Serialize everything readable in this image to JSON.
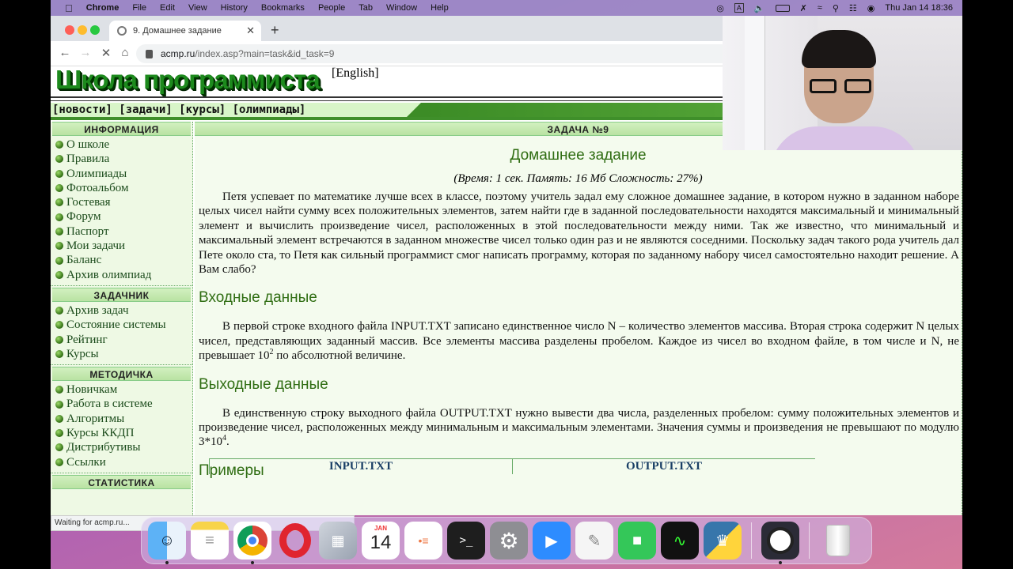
{
  "menubar": {
    "app": "Chrome",
    "items": [
      "File",
      "Edit",
      "View",
      "History",
      "Bookmarks",
      "People",
      "Tab",
      "Window",
      "Help"
    ],
    "clock": "Thu Jan 14  18:36",
    "input_source": "A"
  },
  "browser": {
    "tab_title": "9. Домашнее задание",
    "url_host": "acmp.ru",
    "url_path": "/index.asp?main=task&id_task=9",
    "status_text": "Waiting for acmp.ru..."
  },
  "site": {
    "logo": "Школа программиста",
    "lang_link": "[English]",
    "topnav": [
      "[новости]",
      "[задачи]",
      "[курсы]",
      "[олимпиады]"
    ]
  },
  "sidebar": {
    "sections": [
      {
        "title": "ИНФОРМАЦИЯ",
        "items": [
          "О школе",
          "Правила",
          "Олимпиады",
          "Фотоальбом",
          "Гостевая",
          "Форум",
          "Паспорт",
          "Мои задачи",
          "Баланс",
          "Архив олимпиад"
        ]
      },
      {
        "title": "ЗАДАЧНИК",
        "items": [
          "Архив задач",
          "Состояние системы",
          "Рейтинг",
          "Курсы"
        ]
      },
      {
        "title": "МЕТОДИЧКА",
        "items": [
          "Новичкам",
          "Работа в системе",
          "Алгоритмы",
          "Курсы ККДП",
          "Дистрибутивы",
          "Ссылки"
        ]
      },
      {
        "title": "СТАТИСТИКА",
        "items": []
      }
    ]
  },
  "task": {
    "header": "ЗАДАЧА №9",
    "title": "Домашнее задание",
    "limits": "(Время: 1 сек. Память: 16 Мб Сложность: 27%)",
    "statement": "Петя успевает по математике лучше всех в классе, поэтому учитель задал ему сложное домашнее задание, в котором нужно в заданном наборе целых чисел найти сумму всех положительных элементов, затем найти где в заданной последовательности находятся максимальный и минимальный элемент и вычислить произведение чисел, расположенных в этой последовательности между ними. Так же известно, что минимальный и максимальный элемент встречаются в заданном множестве чисел только один раз и не являются соседними. Поскольку задач такого рода учитель дал Пете около ста, то Петя как сильный программист смог написать программу, которая по заданному набору чисел самостоятельно находит решение. А Вам слабо?",
    "input_heading": "Входные данные",
    "input_text": "В первой строке входного файла INPUT.TXT записано единственное число N – количество элементов массива. Вторая строка содержит N целых чисел, представляющих заданный массив. Все элементы массива разделены пробелом. Каждое из чисел во входном файле, в том числе и N, не превышает 10",
    "input_exp": "2",
    "input_tail": " по абсолютной величине.",
    "output_heading": "Выходные данные",
    "output_text": "В единственную строку выходного файла OUTPUT.TXT нужно вывести два числа, разделенных пробелом: сумму положительных элементов и произведение чисел, расположенных между минимальным и максимальным элементами. Значения суммы и произведения не превышают по модулю 3*10",
    "output_exp": "4",
    "output_tail": ".",
    "examples_heading": "Примеры",
    "examples_cols": [
      "INPUT.TXT",
      "OUTPUT.TXT"
    ]
  },
  "dock": {
    "calendar_month": "JAN",
    "calendar_day": "14"
  }
}
